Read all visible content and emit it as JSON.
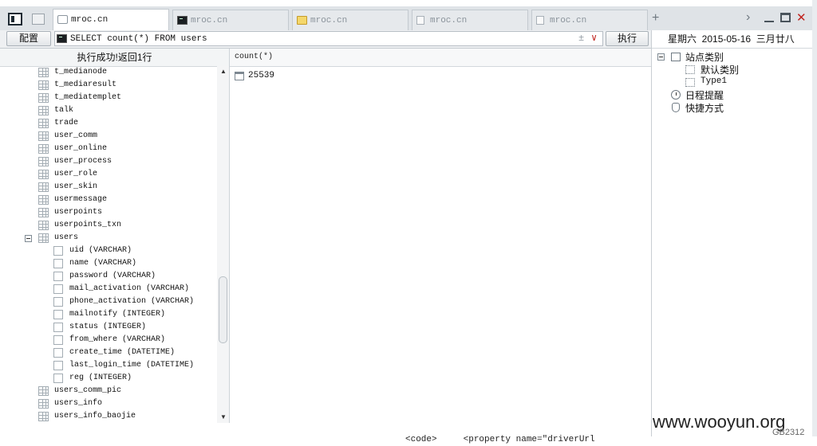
{
  "tabs": [
    {
      "label": "mroc.cn",
      "icon": "page-icon",
      "active": true
    },
    {
      "label": "mroc.cn",
      "icon": "terminal-icon",
      "active": false
    },
    {
      "label": "mroc.cn",
      "icon": "folder-icon",
      "active": false
    },
    {
      "label": "mroc.cn",
      "icon": "document-icon",
      "active": false
    },
    {
      "label": "mroc.cn",
      "icon": "document-icon",
      "active": false
    }
  ],
  "toolbar": {
    "plus": "+",
    "chevron": "›",
    "close": "✕"
  },
  "query": {
    "config_label": "配置",
    "sql": "SELECT count(*) FROM users",
    "plusminus": "±",
    "dropdown": "∨",
    "execute_label": "执行"
  },
  "left_panel": {
    "status": "执行成功!返回1行",
    "scroll_up": "▲",
    "scroll_down": "▼"
  },
  "tree": [
    {
      "label": "t_medianode",
      "type": "table"
    },
    {
      "label": "t_mediaresult",
      "type": "table"
    },
    {
      "label": "t_mediatemplet",
      "type": "table"
    },
    {
      "label": "talk",
      "type": "table"
    },
    {
      "label": "trade",
      "type": "table"
    },
    {
      "label": "user_comm",
      "type": "table"
    },
    {
      "label": "user_online",
      "type": "table"
    },
    {
      "label": "user_process",
      "type": "table"
    },
    {
      "label": "user_role",
      "type": "table"
    },
    {
      "label": "user_skin",
      "type": "table"
    },
    {
      "label": "usermessage",
      "type": "table"
    },
    {
      "label": "userpoints",
      "type": "table"
    },
    {
      "label": "userpoints_txn",
      "type": "table"
    },
    {
      "label": "users",
      "type": "table",
      "expanded": true
    },
    {
      "label": "uid (VARCHAR)",
      "type": "column"
    },
    {
      "label": "name (VARCHAR)",
      "type": "column"
    },
    {
      "label": "password (VARCHAR)",
      "type": "column"
    },
    {
      "label": "mail_activation (VARCHAR)",
      "type": "column"
    },
    {
      "label": "phone_activation (VARCHAR)",
      "type": "column"
    },
    {
      "label": "mailnotify (INTEGER)",
      "type": "column"
    },
    {
      "label": "status (INTEGER)",
      "type": "column"
    },
    {
      "label": "from_where (VARCHAR)",
      "type": "column"
    },
    {
      "label": "create_time (DATETIME)",
      "type": "column"
    },
    {
      "label": "last_login_time (DATETIME)",
      "type": "column"
    },
    {
      "label": "reg (INTEGER)",
      "type": "column"
    },
    {
      "label": "users_comm_pic",
      "type": "table"
    },
    {
      "label": "users_info",
      "type": "table"
    },
    {
      "label": "users_info_baojie",
      "type": "table"
    }
  ],
  "result": {
    "column_header": "count(*)",
    "value": "25539"
  },
  "right_panel": {
    "date": "星期六  2015-05-16  三月廿八",
    "nodes": {
      "sites": "站点类别",
      "default_category": "默认类别",
      "type1": "Type1",
      "schedule": "日程提醒",
      "shortcuts": "快捷方式"
    }
  },
  "background": {
    "code_snippet": "<code>     <property name=\"driverUrl",
    "watermark": "www.wooyun.org",
    "watermark_small": "GB2312"
  }
}
